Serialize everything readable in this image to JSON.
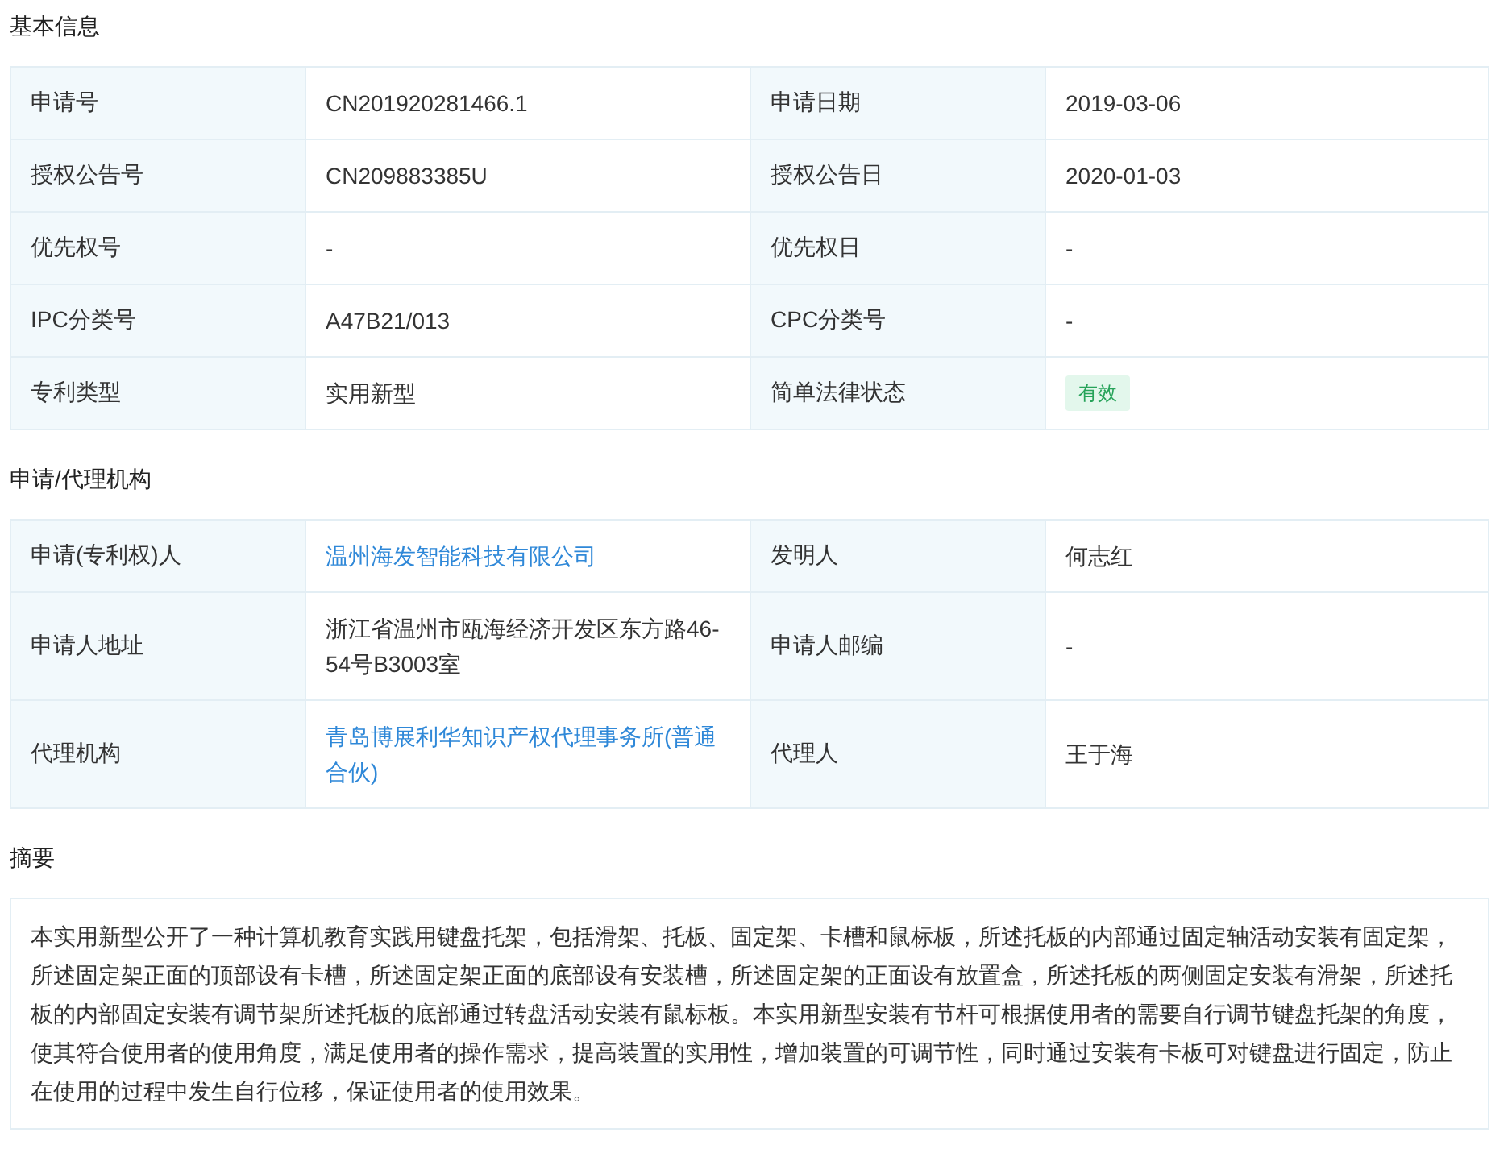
{
  "sections": [
    {
      "title": "基本信息",
      "rows": [
        [
          {
            "label": "申请号",
            "value": "CN201920281466.1",
            "kind": "text"
          },
          {
            "label": "申请日期",
            "value": "2019-03-06",
            "kind": "text"
          }
        ],
        [
          {
            "label": "授权公告号",
            "value": "CN209883385U",
            "kind": "text"
          },
          {
            "label": "授权公告日",
            "value": "2020-01-03",
            "kind": "text"
          }
        ],
        [
          {
            "label": "优先权号",
            "value": "-",
            "kind": "text"
          },
          {
            "label": "优先权日",
            "value": "-",
            "kind": "text"
          }
        ],
        [
          {
            "label": "IPC分类号",
            "value": "A47B21/013",
            "kind": "text"
          },
          {
            "label": "CPC分类号",
            "value": "-",
            "kind": "text"
          }
        ],
        [
          {
            "label": "专利类型",
            "value": "实用新型",
            "kind": "text"
          },
          {
            "label": "简单法律状态",
            "value": "有效",
            "kind": "tag"
          }
        ]
      ]
    },
    {
      "title": "申请/代理机构",
      "rows": [
        [
          {
            "label": "申请(专利权)人",
            "value": "温州海发智能科技有限公司",
            "kind": "link"
          },
          {
            "label": "发明人",
            "value": "何志红",
            "kind": "text"
          }
        ],
        [
          {
            "label": "申请人地址",
            "value": "浙江省温州市瓯海经济开发区东方路46-54号B3003室",
            "kind": "text"
          },
          {
            "label": "申请人邮编",
            "value": "-",
            "kind": "text"
          }
        ],
        [
          {
            "label": "代理机构",
            "value": "青岛博展利华知识产权代理事务所(普通合伙)",
            "kind": "link"
          },
          {
            "label": "代理人",
            "value": "王于海",
            "kind": "text"
          }
        ]
      ]
    }
  ],
  "abstract": {
    "title": "摘要",
    "text": "本实用新型公开了一种计算机教育实践用键盘托架，包括滑架、托板、固定架、卡槽和鼠标板，所述托板的内部通过固定轴活动安装有固定架，所述固定架正面的顶部设有卡槽，所述固定架正面的底部设有安装槽，所述固定架的正面设有放置盒，所述托板的两侧固定安装有滑架，所述托板的内部固定安装有调节架所述托板的底部通过转盘活动安装有鼠标板。本实用新型安装有节杆可根据使用者的需要自行调节键盘托架的角度，使其符合使用者的使用角度，满足使用者的操作需求，提高装置的实用性，增加装置的可调节性，同时通过安装有卡板可对键盘进行固定，防止在使用的过程中发生自行位移，保证使用者的使用效果。"
  }
}
